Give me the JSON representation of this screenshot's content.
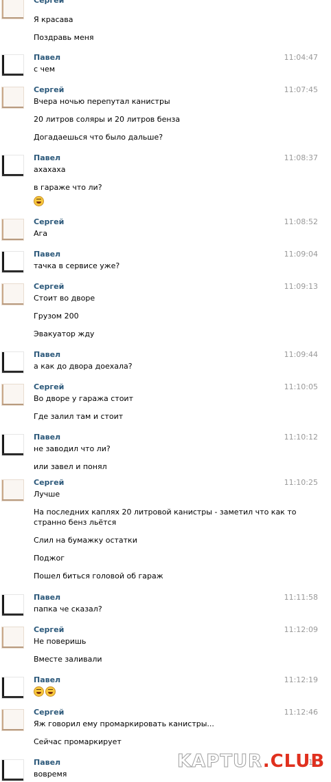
{
  "watermark": {
    "part1": "KAPTUR",
    "dot": ".",
    "part2": "CLUB"
  },
  "colors": {
    "author": "#2b587a",
    "time": "#999999",
    "text": "#000000",
    "watermark_accent": "#e0301e"
  },
  "messages": [
    {
      "author": "Сергей",
      "time": "",
      "avatar": "light",
      "lines": [
        "Я красава",
        "Поздравь меня"
      ]
    },
    {
      "author": "Павел",
      "time": "11:04:47",
      "avatar": "dark",
      "lines": [
        "с чем"
      ]
    },
    {
      "author": "Сергей",
      "time": "11:07:45",
      "avatar": "light",
      "lines": [
        "Вчера ночью перепутал канистры",
        "20 литров соляры и 20 литров бенза",
        "Догадаешься что было дальше?"
      ]
    },
    {
      "author": "Павел",
      "time": "11:08:37",
      "avatar": "dark",
      "lines": [
        "ахахаха",
        "в гараже что ли?"
      ],
      "emoji_count": 1
    },
    {
      "author": "Сергей",
      "time": "11:08:52",
      "avatar": "light",
      "lines": [
        "Ага"
      ]
    },
    {
      "author": "Павел",
      "time": "11:09:04",
      "avatar": "dark",
      "lines": [
        "тачка в сервисе уже?"
      ]
    },
    {
      "author": "Сергей",
      "time": "11:09:13",
      "avatar": "light",
      "lines": [
        "Стоит во дворе",
        "Грузом 200",
        "Эвакуатор жду"
      ]
    },
    {
      "author": "Павел",
      "time": "11:09:44",
      "avatar": "dark",
      "lines": [
        "а как до двора доехала?"
      ]
    },
    {
      "author": "Сергей",
      "time": "11:10:05",
      "avatar": "light",
      "lines": [
        "Во дворе у гаража стоит",
        "Где залил там и стоит"
      ]
    },
    {
      "author": "Павел",
      "time": "11:10:12",
      "avatar": "dark",
      "lines": [
        "не заводил что ли?",
        "или завел и понял"
      ]
    },
    {
      "author": "Сергей",
      "time": "11:10:25",
      "avatar": "light",
      "lines": [
        "Лучше",
        "На последних каплях 20 литровой канистры - заметил что как то",
        "странно бенз льётся",
        "Слил на бумажку остатки",
        "Поджог",
        "Пошел биться головой об гараж"
      ]
    },
    {
      "author": "Павел",
      "time": "11:11:58",
      "avatar": "dark",
      "lines": [
        "папка че сказал?"
      ]
    },
    {
      "author": "Сергей",
      "time": "11:12:09",
      "avatar": "light",
      "lines": [
        "Не поверишь",
        "Вместе заливали"
      ]
    },
    {
      "author": "Павел",
      "time": "11:12:19",
      "avatar": "dark",
      "lines": [],
      "emoji_count": 2
    },
    {
      "author": "Сергей",
      "time": "11:12:46",
      "avatar": "light",
      "lines": [
        "Яж говорил ему промаркировать канистры...",
        "Сейчас промаркирует"
      ]
    },
    {
      "author": "Павел",
      "time": "11",
      "avatar": "dark",
      "lines": [
        "вовремя"
      ]
    }
  ]
}
